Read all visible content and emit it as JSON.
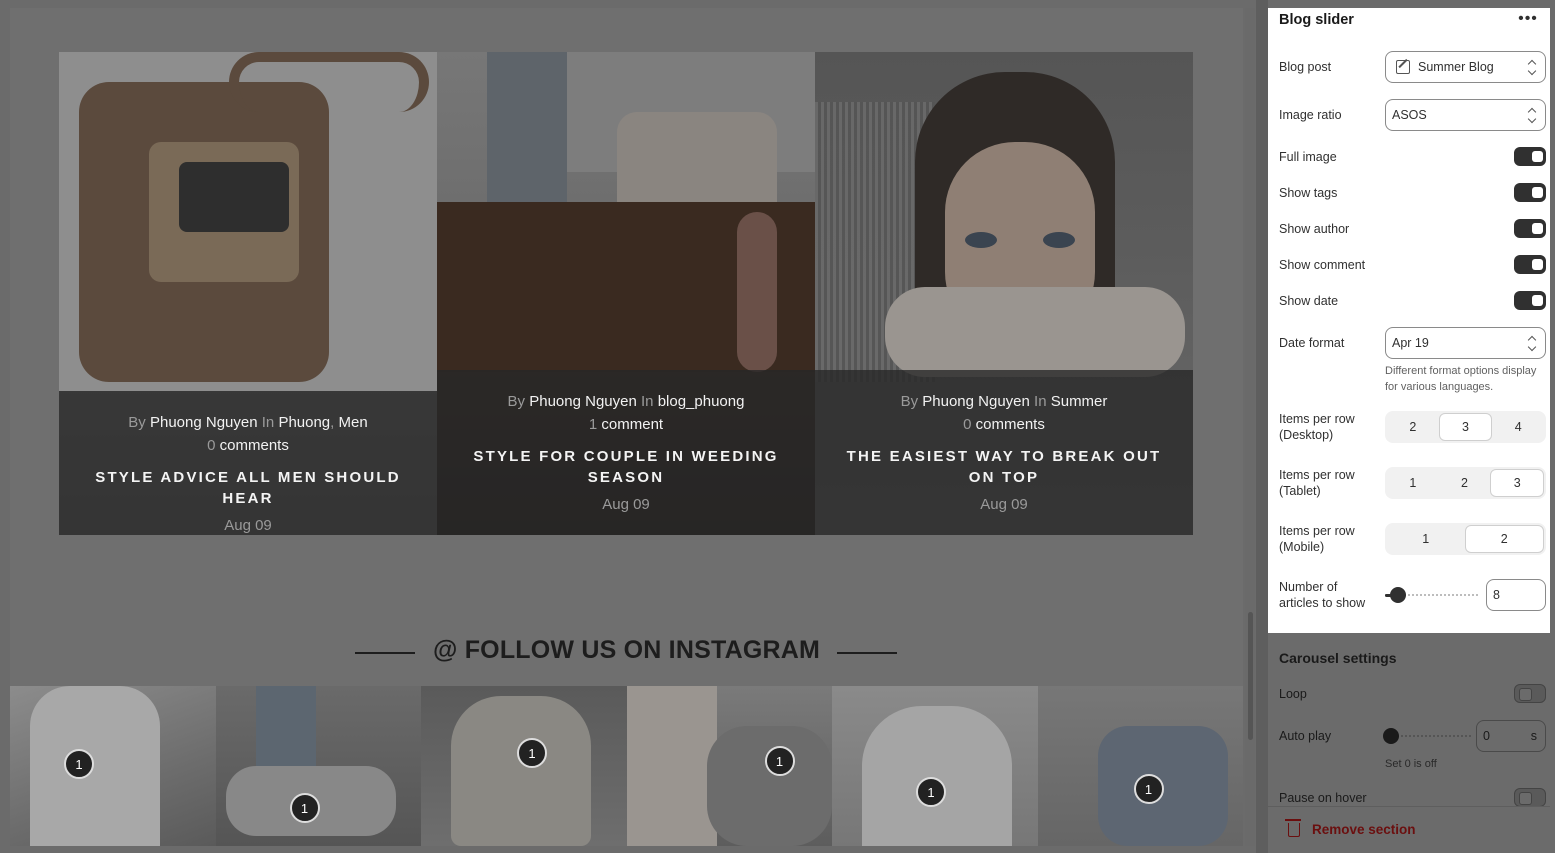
{
  "blog_posts": [
    {
      "by_label": "By",
      "author": "Phuong Nguyen",
      "in_label": "In",
      "tags": [
        "Phuong",
        "Men"
      ],
      "comment_count": "0",
      "comment_label": "comments",
      "title": "STYLE ADVICE ALL MEN SHOULD HEAR",
      "date": "Aug 09"
    },
    {
      "by_label": "By",
      "author": "Phuong Nguyen",
      "in_label": "In",
      "tags": [
        "blog_phuong"
      ],
      "comment_count": "1",
      "comment_label": "comment",
      "title": "STYLE FOR COUPLE IN WEEDING SEASON",
      "date": "Aug 09"
    },
    {
      "by_label": "By",
      "author": "Phuong Nguyen",
      "in_label": "In",
      "tags": [
        "Summer"
      ],
      "comment_count": "0",
      "comment_label": "comments",
      "title": "THE EASIEST WAY TO BREAK OUT ON TOP",
      "date": "Aug 09"
    }
  ],
  "instagram": {
    "heading": "@ FOLLOW US ON INSTAGRAM",
    "tiles": [
      {
        "badge": "1"
      },
      {
        "badge": "1"
      },
      {
        "badge": "1"
      },
      {
        "badge": "1"
      },
      {
        "badge": "1"
      },
      {
        "badge": "1"
      }
    ]
  },
  "panel": {
    "title": "Blog slider",
    "more": "•••",
    "blog_post": {
      "label": "Blog post",
      "value": "Summer Blog"
    },
    "image_ratio": {
      "label": "Image ratio",
      "value": "ASOS"
    },
    "toggles": {
      "full_image": {
        "label": "Full image",
        "on": true
      },
      "show_tags": {
        "label": "Show tags",
        "on": true
      },
      "show_author": {
        "label": "Show author",
        "on": true
      },
      "show_comment": {
        "label": "Show comment",
        "on": true
      },
      "show_date": {
        "label": "Show date",
        "on": true
      }
    },
    "date_format": {
      "label": "Date format",
      "value": "Apr 19",
      "help": "Different format options display for various languages."
    },
    "items_desktop": {
      "label": "Items per row (Desktop)",
      "options": [
        "2",
        "3",
        "4"
      ],
      "selected": "3"
    },
    "items_tablet": {
      "label": "Items per row (Tablet)",
      "options": [
        "1",
        "2",
        "3"
      ],
      "selected": "3"
    },
    "items_mobile": {
      "label": "Items per row (Mobile)",
      "options": [
        "1",
        "2"
      ],
      "selected": "2"
    },
    "articles": {
      "label": "Number of articles to show",
      "value": "8",
      "level": 0.14
    }
  },
  "carousel": {
    "title": "Carousel settings",
    "loop": {
      "label": "Loop",
      "on": false
    },
    "auto_play": {
      "label": "Auto play",
      "value": "0",
      "unit": "s",
      "help": "Set 0 is off",
      "level": 0
    },
    "pause_on_hover": {
      "label": "Pause on hover",
      "on": false
    }
  },
  "remove_section": {
    "label": "Remove section"
  },
  "colors": {
    "accent": "#303030",
    "danger": "#8e1f0b",
    "panel_bg": "#ffffff"
  }
}
